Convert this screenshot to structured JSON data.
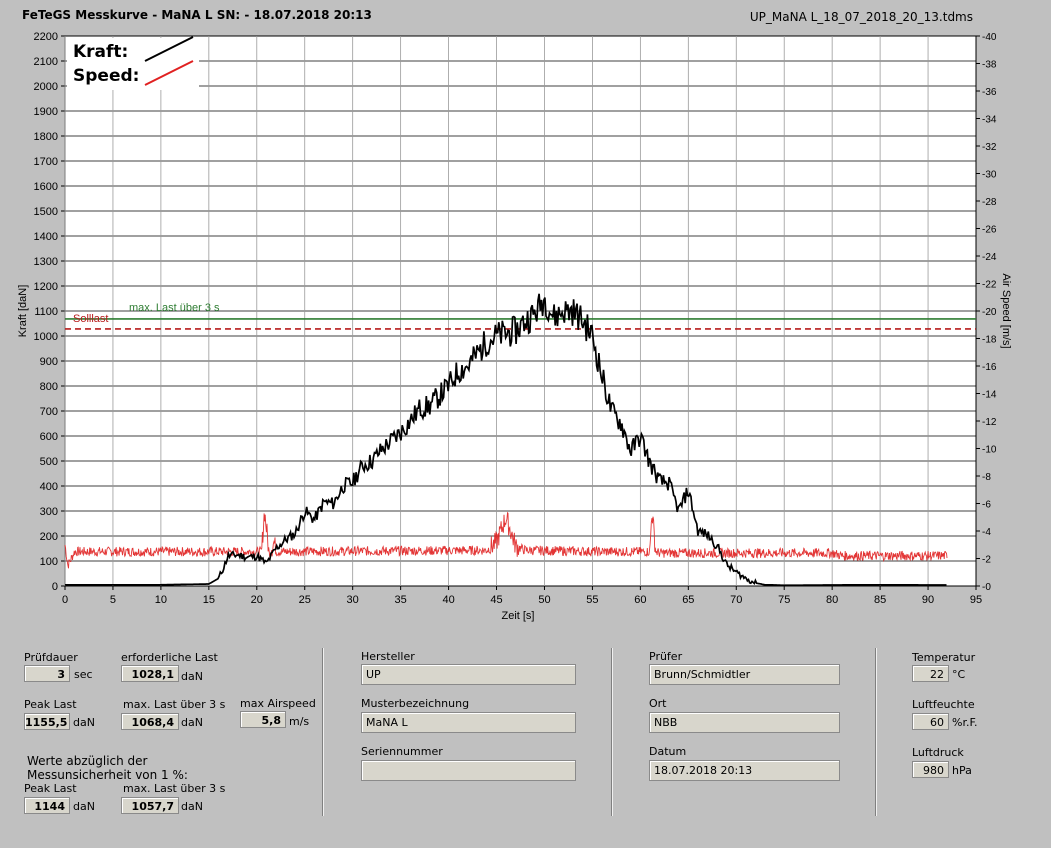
{
  "header": {
    "title": "FeTeGS Messkurve - MaNA L  SN:  - 18.07.2018 20:13",
    "filename": "UP_MaNA L_18_07_2018_20_13.tdms"
  },
  "chart_data": {
    "type": "line",
    "xlabel": "Zeit [s]",
    "ylabel_left": "Kraft [daN]",
    "ylabel_right": "Air Speed [m/s]",
    "xlim": [
      0,
      95
    ],
    "ylim_left": [
      0,
      2200
    ],
    "ylim_right": [
      0,
      40
    ],
    "x_ticks": [
      0,
      5,
      10,
      15,
      20,
      25,
      30,
      35,
      40,
      45,
      50,
      55,
      60,
      65,
      70,
      75,
      80,
      85,
      90,
      95
    ],
    "y_ticks_left": [
      0,
      100,
      200,
      300,
      400,
      500,
      600,
      700,
      800,
      900,
      1000,
      1100,
      1200,
      1300,
      1400,
      1500,
      1600,
      1700,
      1800,
      1900,
      2000,
      2100,
      2200
    ],
    "y_ticks_right": [
      0,
      2,
      4,
      6,
      8,
      10,
      12,
      14,
      16,
      18,
      20,
      22,
      24,
      26,
      28,
      30,
      32,
      34,
      36,
      38,
      40
    ],
    "grid": true,
    "legend": {
      "position": "top-left",
      "entries": [
        {
          "label": "Kraft:",
          "color": "#000000"
        },
        {
          "label": "Speed:",
          "color": "#e02020"
        }
      ]
    },
    "reference_lines": [
      {
        "label": "max. Last über  3 s",
        "value": 1068.4,
        "color": "#2e7d32",
        "style": "solid"
      },
      {
        "label": "Solllast",
        "value": 1028.1,
        "color": "#b71c1c",
        "style": "dashed"
      }
    ],
    "series": [
      {
        "name": "Kraft",
        "axis": "left",
        "color": "#000000",
        "x": [
          0,
          10,
          15,
          16,
          16.5,
          17,
          18,
          19,
          20,
          21,
          22,
          23,
          24,
          25,
          26,
          27,
          28,
          29,
          30,
          31,
          32,
          33,
          34,
          35,
          36,
          37,
          38,
          39,
          40,
          41,
          42,
          43,
          44,
          45,
          46,
          47,
          48,
          49,
          50,
          51,
          52,
          53,
          54,
          55,
          56,
          57,
          58,
          59,
          60,
          61,
          62,
          63,
          64,
          65,
          66,
          67,
          68,
          69,
          70,
          71,
          72,
          73,
          75,
          80,
          85,
          90,
          92
        ],
        "y": [
          5,
          5,
          8,
          30,
          70,
          120,
          125,
          115,
          120,
          90,
          150,
          185,
          210,
          300,
          265,
          335,
          330,
          400,
          415,
          480,
          500,
          545,
          580,
          615,
          660,
          710,
          720,
          760,
          800,
          860,
          880,
          930,
          980,
          1000,
          1010,
          1020,
          1060,
          1090,
          1150,
          1075,
          1100,
          1100,
          1060,
          1000,
          840,
          700,
          650,
          540,
          600,
          490,
          420,
          410,
          300,
          385,
          220,
          205,
          160,
          85,
          55,
          30,
          12,
          5,
          3,
          4,
          5,
          4,
          4
        ]
      },
      {
        "name": "Speed",
        "axis": "right",
        "color": "#e02020",
        "x": [
          0,
          0.3,
          1,
          20.5,
          20.8,
          21.3,
          21.8,
          22,
          44,
          45,
          46,
          47,
          48,
          56,
          61,
          61.2,
          61.6,
          62,
          80,
          81,
          92
        ],
        "y": [
          3,
          1.5,
          2.5,
          2.5,
          5.5,
          2.3,
          3.2,
          2.5,
          2.6,
          3.2,
          5.0,
          2.9,
          2.6,
          2.5,
          2.5,
          5.5,
          2.5,
          2.4,
          2.4,
          2.2,
          2.2
        ],
        "noise": 0.35
      }
    ]
  },
  "panel": {
    "pruefdauer": {
      "label": "Prüfdauer",
      "value": "3",
      "unit": "sec"
    },
    "erforderliche_last": {
      "label": "erforderliche Last",
      "value": "1028,1",
      "unit": "daN"
    },
    "peak_last": {
      "label": "Peak Last",
      "value": "1155,5",
      "unit": "daN"
    },
    "max_last": {
      "label": "max. Last über  3 s",
      "value": "1068,4",
      "unit": "daN"
    },
    "max_airspeed": {
      "label": "max Airspeed",
      "value": "5,8",
      "unit": "m/s"
    },
    "note_line1": "Werte abzüglich der",
    "note_line2": "Messunsicherheit von 1   %:",
    "peak_last_corr": {
      "label": "Peak Last",
      "value": "1144",
      "unit": "daN"
    },
    "max_last_corr": {
      "label": "max. Last über  3 s",
      "value": "1057,7",
      "unit": "daN"
    },
    "hersteller": {
      "label": "Hersteller",
      "value": "UP"
    },
    "musterbezeichnung": {
      "label": "Musterbezeichnung",
      "value": "MaNA L"
    },
    "seriennummer": {
      "label": "Seriennummer",
      "value": ""
    },
    "pruefer": {
      "label": "Prüfer",
      "value": "Brunn/Schmidtler"
    },
    "ort": {
      "label": "Ort",
      "value": "NBB"
    },
    "datum": {
      "label": "Datum",
      "value": "18.07.2018 20:13"
    },
    "temperatur": {
      "label": "Temperatur",
      "value": "22",
      "unit": "°C"
    },
    "luftfeuchte": {
      "label": "Luftfeuchte",
      "value": "60",
      "unit": "%r.F."
    },
    "luftdruck": {
      "label": "Luftdruck",
      "value": "980",
      "unit": "hPa"
    }
  }
}
